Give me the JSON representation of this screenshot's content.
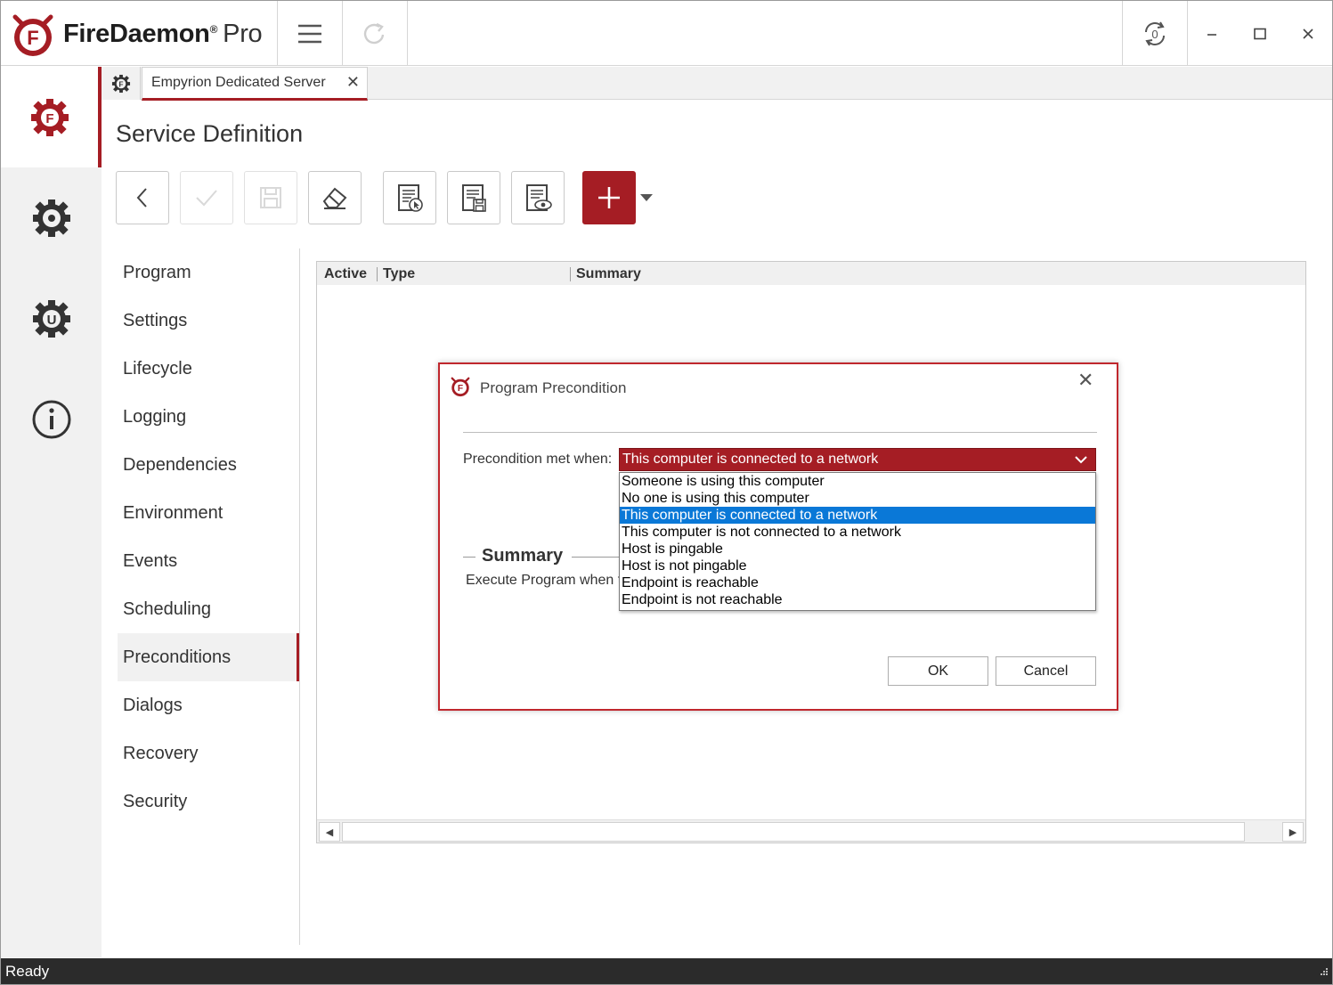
{
  "app": {
    "brand": "FireDaemon",
    "registered": "®",
    "edition": "Pro"
  },
  "titlebar": {
    "menu_icon": "hamburger-icon",
    "refresh_icon": "redo-icon",
    "update_icon": "sync-icon",
    "minimize_icon": "minimize-icon",
    "maximize_icon": "maximize-icon",
    "close_icon": "close-icon"
  },
  "rail": {
    "items": [
      {
        "icon": "firedaemon-gear-icon",
        "active": true
      },
      {
        "icon": "gear-icon"
      },
      {
        "icon": "updates-gear-icon"
      },
      {
        "icon": "info-icon"
      }
    ]
  },
  "tab": {
    "label": "Empyrion Dedicated Server",
    "close": "✕"
  },
  "page_title": "Service Definition",
  "toolbar": {
    "buttons": [
      "back-icon",
      "check-icon",
      "save-icon",
      "eraser-icon",
      "document-pointer-icon",
      "document-save-icon",
      "document-view-icon",
      "add-icon"
    ]
  },
  "sidenav": {
    "items": [
      "Program",
      "Settings",
      "Lifecycle",
      "Logging",
      "Dependencies",
      "Environment",
      "Events",
      "Scheduling",
      "Preconditions",
      "Dialogs",
      "Recovery",
      "Security"
    ],
    "active": "Preconditions"
  },
  "grid": {
    "columns": [
      "Active",
      "Type",
      "Summary"
    ]
  },
  "dialog": {
    "title": "Program Precondition",
    "close": "✕",
    "condition_label": "Precondition met when:",
    "selected_value": "This computer is connected to a network",
    "options": [
      "Someone is using this computer",
      "No one is using this computer",
      "This computer is connected to a network",
      "This computer is not connected to a network",
      "Host is pingable",
      "Host is not pingable",
      "Endpoint is reachable",
      "Endpoint is not reachable"
    ],
    "summary_title": "Summary",
    "summary_text": "Execute Program when t",
    "ok_label": "OK",
    "cancel_label": "Cancel"
  },
  "status": {
    "text": "Ready"
  },
  "colors": {
    "accent": "#a51d24",
    "selection": "#0a78d7",
    "statusbar": "#2b2b2b"
  }
}
